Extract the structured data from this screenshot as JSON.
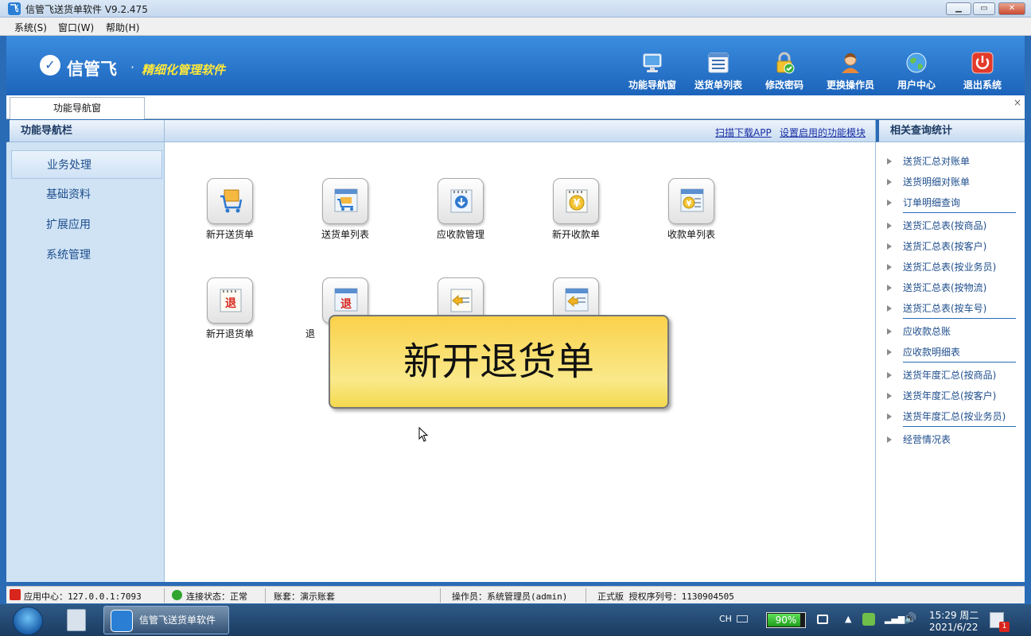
{
  "window": {
    "title": "信管飞送货单软件 V9.2.475",
    "app_icon": "app-logo-icon",
    "controls": {
      "minimize": "▁",
      "maximize": "▭",
      "close": "✕"
    }
  },
  "menu": [
    "系统(S)",
    "窗口(W)",
    "帮助(H)"
  ],
  "banner": {
    "logo": "信管飞",
    "separator": "·",
    "slogan": "精细化管理软件",
    "buttons": [
      {
        "label": "功能导航窗",
        "icon": "monitor-icon"
      },
      {
        "label": "送货单列表",
        "icon": "list-icon"
      },
      {
        "label": "修改密码",
        "icon": "lock-icon"
      },
      {
        "label": "更换操作员",
        "icon": "user-icon"
      },
      {
        "label": "用户中心",
        "icon": "globe-icon"
      },
      {
        "label": "退出系统",
        "icon": "power-icon"
      }
    ]
  },
  "tabs": {
    "active": "功能导航窗",
    "close": "×"
  },
  "left_panel": {
    "title": "功能导航栏",
    "items": [
      "业务处理",
      "基础资料",
      "扩展应用",
      "系统管理"
    ]
  },
  "center": {
    "links": [
      "扫描下载APP",
      "设置启用的功能模块"
    ],
    "functions_row1": [
      "新开送货单",
      "送货单列表",
      "应收款管理",
      "新开收款单",
      "收款单列表"
    ],
    "functions_row2": [
      "新开退货单",
      "退",
      "",
      ""
    ],
    "tooltip": "新开退货单",
    "glyph_text": {
      "return": "退",
      "yen": "¥"
    }
  },
  "right_panel": {
    "title": "相关查询统计",
    "links": [
      "送货汇总对账单",
      "送货明细对账单",
      "订单明细查询",
      "送货汇总表(按商品)",
      "送货汇总表(按客户)",
      "送货汇总表(按业务员)",
      "送货汇总表(按物流)",
      "送货汇总表(按车号)",
      "应收款总账",
      "应收款明细表",
      "送货年度汇总(按商品)",
      "送货年度汇总(按客户)",
      "送货年度汇总(按业务员)",
      "经营情况表"
    ]
  },
  "status": {
    "app_center": "应用中心：127.0.0.1:7093",
    "connection": "连接状态：正常",
    "account": "账套：演示账套",
    "operator": "操作员：系统管理员(admin)",
    "license": "正式版 授权序列号：1130904505"
  },
  "taskbar": {
    "window_title": "信管飞送货单软件",
    "ime": "CH",
    "battery": "90%",
    "battery_level": 0.9,
    "time": "15:29 周二",
    "date": "2021/6/22",
    "notification_count": "1"
  },
  "colors": {
    "accent": "#2a6bb5",
    "banner": "#1c64bb",
    "slogan": "#ffe83a",
    "tooltip": "#fbd14b"
  }
}
